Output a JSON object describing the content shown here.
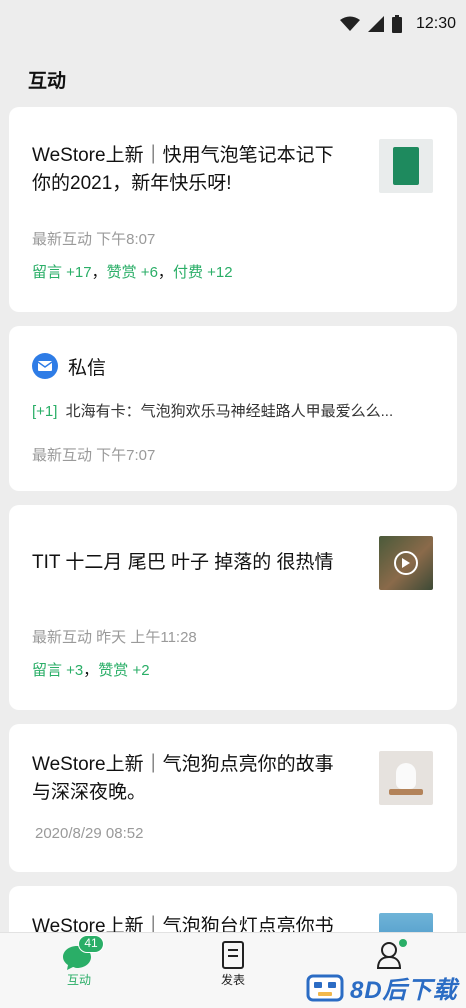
{
  "status_bar": {
    "time": "12:30"
  },
  "page": {
    "title": "互动"
  },
  "cards": [
    {
      "title_line1": "WeStore上新｜快用气泡笔记本记下",
      "title_line2": "你的2021，新年快乐呀!",
      "meta": "最新互动  下午8:07",
      "stats": [
        {
          "label": "留言 +17"
        },
        {
          "label": "赞赏 +6"
        },
        {
          "label": "付费 +12"
        }
      ]
    },
    {
      "header": "私信",
      "badge": "[+1]",
      "message": "北海有卡：气泡狗欢乐马神经蛙路人甲最爱么么...",
      "meta": "最新互动  下午7:07"
    },
    {
      "title": "TIT 十二月 尾巴 叶子 掉落的 很热情",
      "meta": "最新互动 昨天 上午11:28",
      "stats": [
        {
          "label": "留言 +3"
        },
        {
          "label": "赞赏 +2"
        }
      ]
    },
    {
      "title_line1": "WeStore上新｜气泡狗点亮你的故事",
      "title_line2": "与深深夜晚。",
      "meta": "2020/8/29  08:52"
    },
    {
      "title_line1": "WeStore上新｜气泡狗台灯点亮你书"
    }
  ],
  "tabbar": {
    "tabs": [
      {
        "label": "互动",
        "badge": "41"
      },
      {
        "label": "发表"
      },
      {
        "label": "我"
      }
    ]
  },
  "watermark": {
    "text": "8D后下载"
  },
  "colors": {
    "accent": "#2aae67",
    "background": "#ededed"
  }
}
